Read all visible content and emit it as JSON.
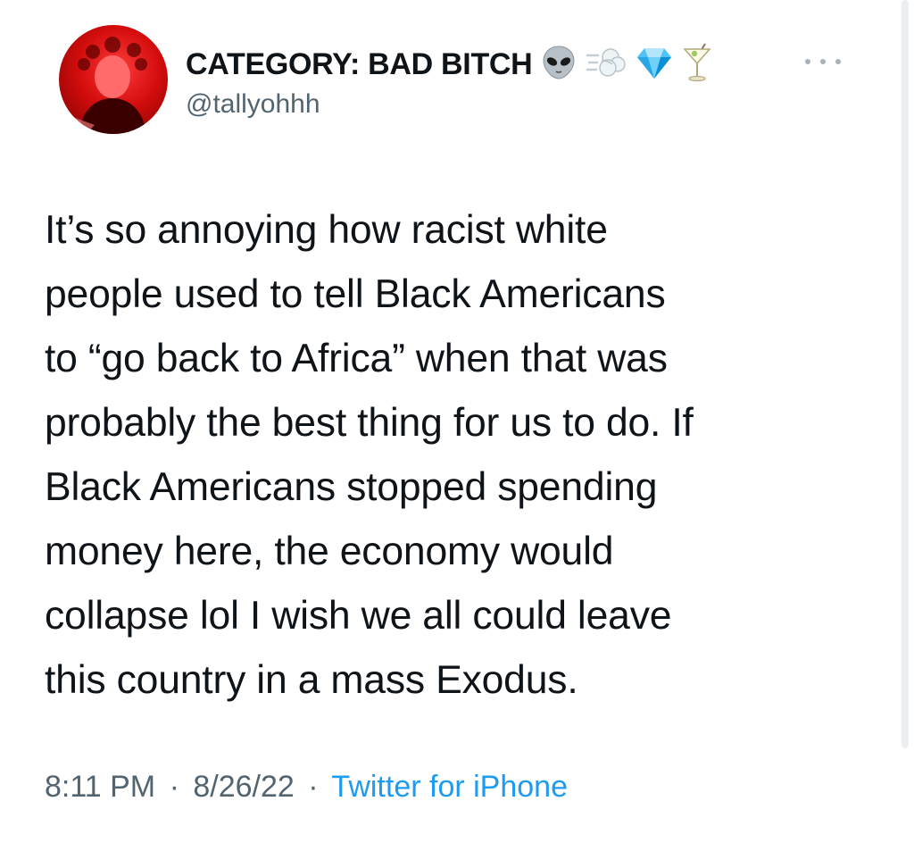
{
  "user": {
    "display_name": "CATEGORY: BAD BITCH",
    "name_emojis": [
      "alien-emoji",
      "dash-emoji",
      "gem-emoji",
      "cocktail-emoji"
    ],
    "handle": "@tallyohhh",
    "avatar_icon": "user-avatar"
  },
  "menu": {
    "more_icon": "more-options-icon"
  },
  "tweet": {
    "lines": [
      "It’s so annoying how racist white",
      "people used to tell Black Americans",
      "to “go back to Africa” when that was",
      "probably the best thing for us to do. If",
      "Black Americans stopped spending",
      "money here, the economy would",
      "collapse lol I wish we all could leave",
      "this country in a mass Exodus."
    ]
  },
  "meta": {
    "time": "8:11 PM",
    "separator": "·",
    "date": "8/26/22",
    "source": "Twitter for iPhone"
  },
  "colors": {
    "text": "#0f1419",
    "secondary": "#536471",
    "link": "#1d9bf0",
    "avatar_bg": "#d40d0d"
  }
}
